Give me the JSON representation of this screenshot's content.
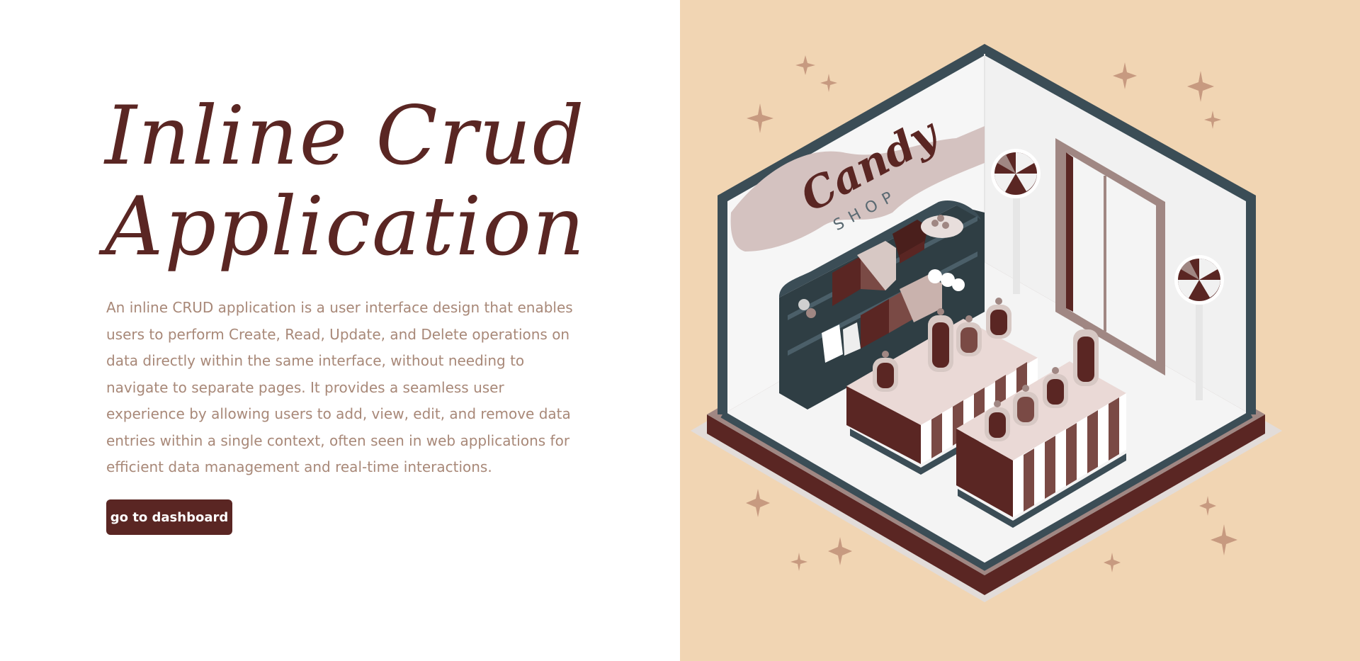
{
  "hero": {
    "title_line1": "Inline Crud",
    "title_line2": "Application",
    "description": "An inline CRUD application is a user interface design that enables users to perform Create, Read, Update, and Delete operations on data directly within the same interface, without needing to navigate to separate pages. It provides a seamless user experience by allowing users to add, view, edit, and remove data entries within a single context, often seen in web applications for efficient data management and real-time interactions.",
    "cta_label": "go to dashboard"
  },
  "illustration": {
    "sign_title": "Candy",
    "sign_subtitle": "SHOP"
  },
  "colors": {
    "brand": "#5a2623",
    "text_muted": "#a88878",
    "panel_bg": "#f1d5b3",
    "wall_trim": "#3b4d56"
  }
}
